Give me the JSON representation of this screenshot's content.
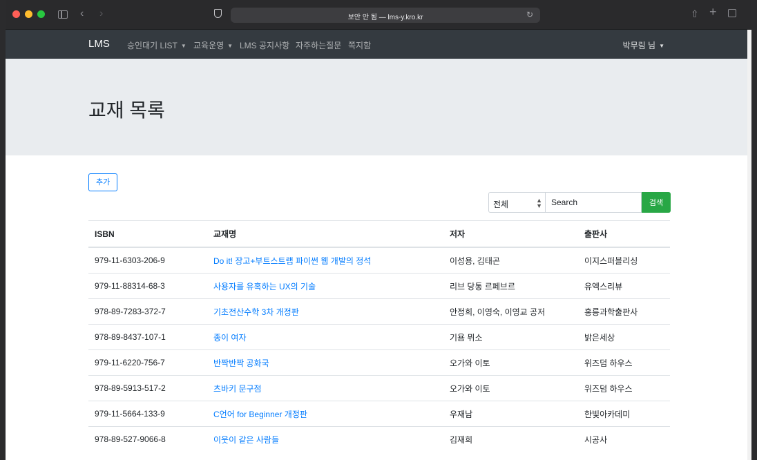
{
  "browser": {
    "url_text": "보안 안 됨 — lms-y.kro.kr"
  },
  "navbar": {
    "brand": "LMS",
    "items": [
      {
        "label": "승인대기 LIST",
        "dropdown": true
      },
      {
        "label": "교육운영",
        "dropdown": true
      },
      {
        "label": "LMS 공지사항",
        "dropdown": false
      },
      {
        "label": "자주하는질문",
        "dropdown": false
      },
      {
        "label": "쪽지함",
        "dropdown": false
      }
    ],
    "user": "박무림 님"
  },
  "header": {
    "title": "교재 목록"
  },
  "actions": {
    "add_label": "추가"
  },
  "search": {
    "filter_value": "전체",
    "placeholder": "Search",
    "button_label": "검색"
  },
  "table": {
    "columns": [
      "ISBN",
      "교재명",
      "저자",
      "출판사"
    ],
    "rows": [
      {
        "isbn": "979-11-6303-206-9",
        "title": "Do it! 장고+부트스트랩 파이썬 웹 개발의 정석",
        "author": "이성용, 김태곤",
        "publisher": "이지스퍼블리싱"
      },
      {
        "isbn": "979-11-88314-68-3",
        "title": "사용자를 유혹하는 UX의 기술",
        "author": "리브 당통 르페브르",
        "publisher": "유엑스리뷰"
      },
      {
        "isbn": "978-89-7283-372-7",
        "title": "기초전산수학 3차 개정판",
        "author": "안정희, 이영숙, 이영교 공저",
        "publisher": "홍릉과학출판사"
      },
      {
        "isbn": "978-89-8437-107-1",
        "title": "종이 여자",
        "author": "기욤 뮈소",
        "publisher": "밝은세상"
      },
      {
        "isbn": "979-11-6220-756-7",
        "title": "반짝반짝 공화국",
        "author": "오가와 이토",
        "publisher": "위즈덤 하우스"
      },
      {
        "isbn": "978-89-5913-517-2",
        "title": "츠바키 문구점",
        "author": "오가와 이토",
        "publisher": "위즈덤 하우스"
      },
      {
        "isbn": "979-11-5664-133-9",
        "title": "C언어 for Beginner 개정판",
        "author": "우재남",
        "publisher": "한빛아카데미"
      },
      {
        "isbn": "978-89-527-9066-8",
        "title": "이웃이 같은 사람들",
        "author": "김재희",
        "publisher": "시공사"
      }
    ]
  }
}
